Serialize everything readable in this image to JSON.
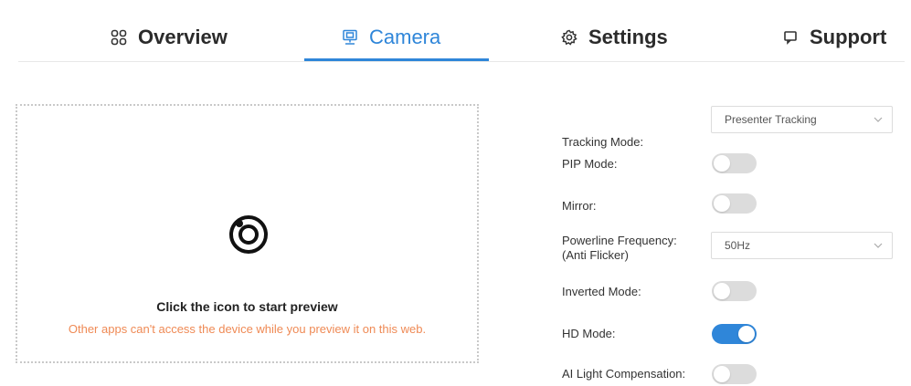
{
  "tabs": [
    {
      "label": "Overview",
      "icon": "grid-icon"
    },
    {
      "label": "Camera",
      "icon": "camera-icon"
    },
    {
      "label": "Settings",
      "icon": "gear-icon"
    },
    {
      "label": "Support",
      "icon": "chat-icon"
    }
  ],
  "active_tab": "Camera",
  "colors": {
    "accent": "#2f86d9",
    "warning": "#ef8a55",
    "toggle_off": "#dcdcdc"
  },
  "preview": {
    "title": "Click the icon to start preview",
    "warning": "Other apps can't access the device while you preview it on this web."
  },
  "settings": {
    "tracking_mode": {
      "label": "Tracking Mode:",
      "value": "Presenter Tracking"
    },
    "pip_mode": {
      "label": "PIP Mode:",
      "on": false
    },
    "mirror": {
      "label": "Mirror:",
      "on": false
    },
    "powerline": {
      "label_line1": "Powerline Frequency:",
      "label_line2": "(Anti Flicker)",
      "value": "50Hz"
    },
    "inverted_mode": {
      "label": "Inverted Mode:",
      "on": false
    },
    "hd_mode": {
      "label": "HD Mode:",
      "on": true
    },
    "ai_light": {
      "label": "AI Light Compensation:",
      "on": false
    }
  }
}
